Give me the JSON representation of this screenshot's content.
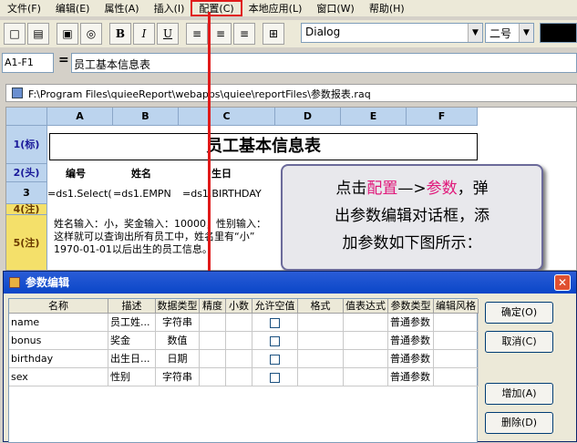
{
  "menu": [
    "文件(F)",
    "编辑(E)",
    "属性(A)",
    "插入(I)",
    "配置(C)",
    "本地应用(L)",
    "窗口(W)",
    "帮助(H)"
  ],
  "toolbar": {
    "bold": "B",
    "italic": "I",
    "underline": "U",
    "font": "Dialog",
    "size": "二号",
    "color": "#000000"
  },
  "formula_bar": {
    "cell_ref": "A1-F1",
    "eq": "=",
    "value": "员工基本信息表"
  },
  "report_window": {
    "path": "F:\\Program Files\\quieeReport\\webapps\\quiee\\reportFiles\\参数报表.raq",
    "columns": [
      "A",
      "B",
      "C",
      "D",
      "E",
      "F"
    ],
    "rows": [
      "1(标)",
      "2(头)",
      "3",
      "4(注)",
      "5(注)"
    ],
    "title": "员工基本信息表",
    "header_cells": [
      "编号",
      "姓名",
      "生日"
    ],
    "data_cells": [
      "=ds1.Select(",
      "=ds1.EMPN",
      "=ds1.BIRTHDAY"
    ],
    "note_lines": [
      "姓名输入：小，奖金输入：10000，性别输入：",
      "这样就可以查询出所有员工中，姓名里有“小”",
      "1970-01-01以后出生的员工信息。"
    ]
  },
  "callout": {
    "line1_pre": "点击",
    "line1_a": "配置",
    "line1_mid": "—>",
    "line1_b": "参数",
    "line1_post": "，弹",
    "line2": "出参数编辑对话框，添",
    "line3": "加参数如下图所示："
  },
  "dialog": {
    "title": "参数编辑",
    "close": "✕",
    "headers": [
      "名称",
      "描述",
      "数据类型",
      "精度",
      "小数",
      "允许空值",
      "格式",
      "值表达式",
      "参数类型",
      "编辑风格"
    ],
    "rows": [
      {
        "name": "name",
        "desc": "员工姓...",
        "type": "字符串",
        "ptype": "普通参数"
      },
      {
        "name": "bonus",
        "desc": "奖金",
        "type": "数值",
        "ptype": "普通参数"
      },
      {
        "name": "birthday",
        "desc": "出生日...",
        "type": "日期",
        "ptype": "普通参数"
      },
      {
        "name": "sex",
        "desc": "性别",
        "type": "字符串",
        "ptype": "普通参数"
      }
    ],
    "buttons": {
      "ok": "确定(O)",
      "cancel": "取消(C)",
      "add": "增加(A)",
      "delete": "删除(D)"
    }
  },
  "colors": {
    "highlight": "#e01a1a",
    "callout_accent": "#e0187a",
    "dialog_title": "#0a46c8"
  }
}
